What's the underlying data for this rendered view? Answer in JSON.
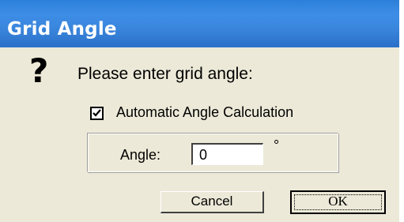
{
  "window": {
    "title": "Grid Angle"
  },
  "icon": {
    "name": "question-icon",
    "glyph": "?"
  },
  "prompt": {
    "text": "Please enter grid angle:"
  },
  "auto_angle": {
    "label": "Automatic Angle Calculation",
    "checked": true
  },
  "angle": {
    "label": "Angle:",
    "value": "0",
    "unit": "°"
  },
  "buttons": {
    "cancel_label": "Cancel",
    "ok_label": "OK"
  },
  "colors": {
    "titlebar": "#3a86dd",
    "dialog_bg": "#ece9d8",
    "title_text": "#ffffff"
  }
}
